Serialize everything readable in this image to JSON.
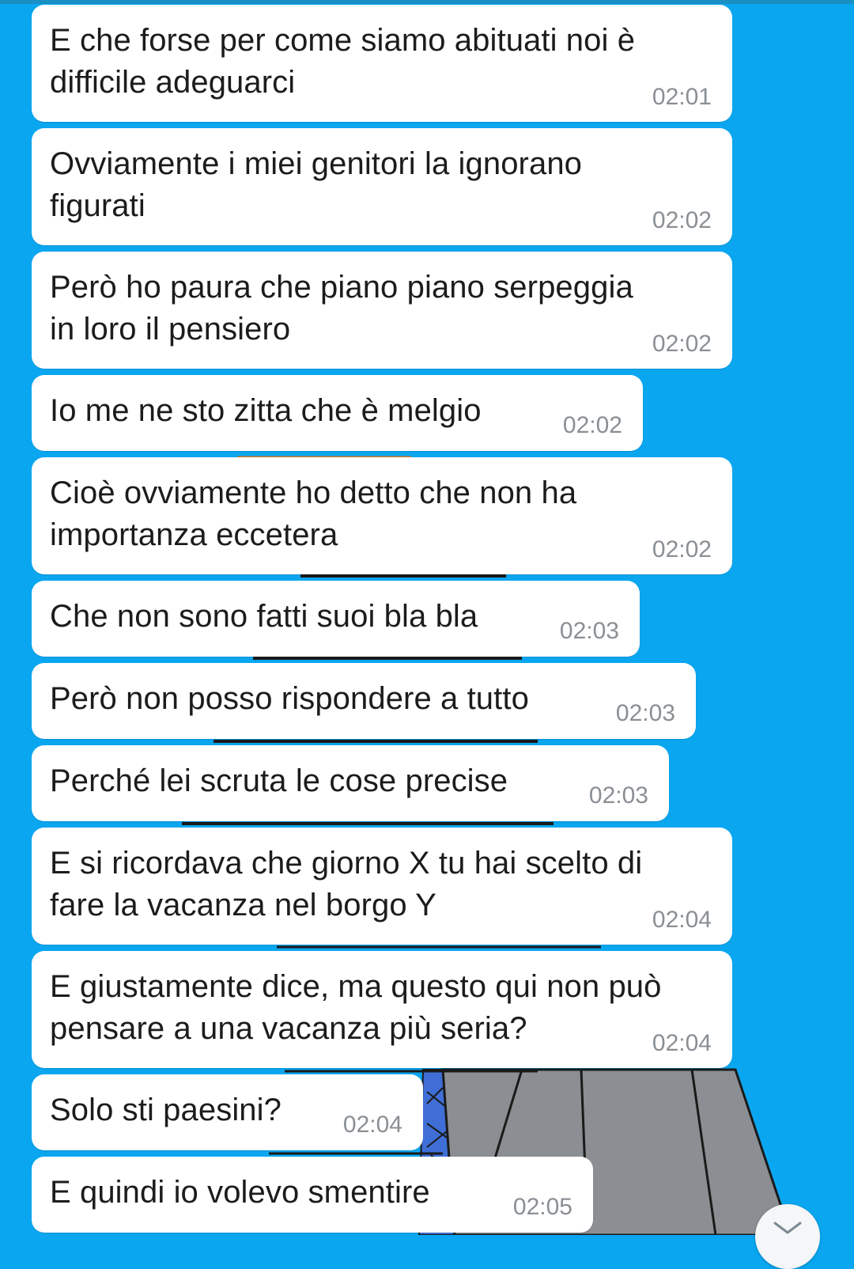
{
  "chat": {
    "messages": [
      {
        "text_lines": [
          "E che forse per come siamo abituati noi è",
          "difficile adeguarci"
        ],
        "time": "02:01"
      },
      {
        "text_lines": [
          "Ovviamente i miei genitori la ignorano",
          "figurati"
        ],
        "time": "02:02"
      },
      {
        "text_lines": [
          "Però ho paura che piano piano serpeggia",
          "in loro il pensiero"
        ],
        "time": "02:02"
      },
      {
        "text_lines": [
          "Io me ne sto zitta che è melgio"
        ],
        "time": "02:02"
      },
      {
        "text_lines": [
          "Cioè ovviamente ho detto che non ha",
          "importanza eccetera"
        ],
        "time": "02:02"
      },
      {
        "text_lines": [
          "Che non sono fatti suoi bla bla"
        ],
        "time": "02:03"
      },
      {
        "text_lines": [
          "Però non posso rispondere a tutto"
        ],
        "time": "02:03"
      },
      {
        "text_lines": [
          "Perché lei scruta le cose precise"
        ],
        "time": "02:03"
      },
      {
        "text_lines": [
          "E si ricordava che giorno X tu hai scelto di",
          "fare la vacanza nel borgo Y"
        ],
        "time": "02:04"
      },
      {
        "text_lines": [
          "E giustamente dice, ma questo qui non può",
          "pensare a una vacanza più seria?"
        ],
        "time": "02:04"
      },
      {
        "text_lines": [
          "Solo sti paesini?"
        ],
        "time": "02:04"
      },
      {
        "text_lines": [
          "E quindi io volevo smentire"
        ],
        "time": "02:05"
      }
    ]
  },
  "colors": {
    "background": "#0aa6f0",
    "bubble": "#ffffff",
    "text": "#1c1c1c",
    "timestamp": "#8a8f94"
  },
  "icons": {
    "scroll_down": "chevron-down-icon",
    "wallpaper": "cartoon-wallpaper"
  }
}
